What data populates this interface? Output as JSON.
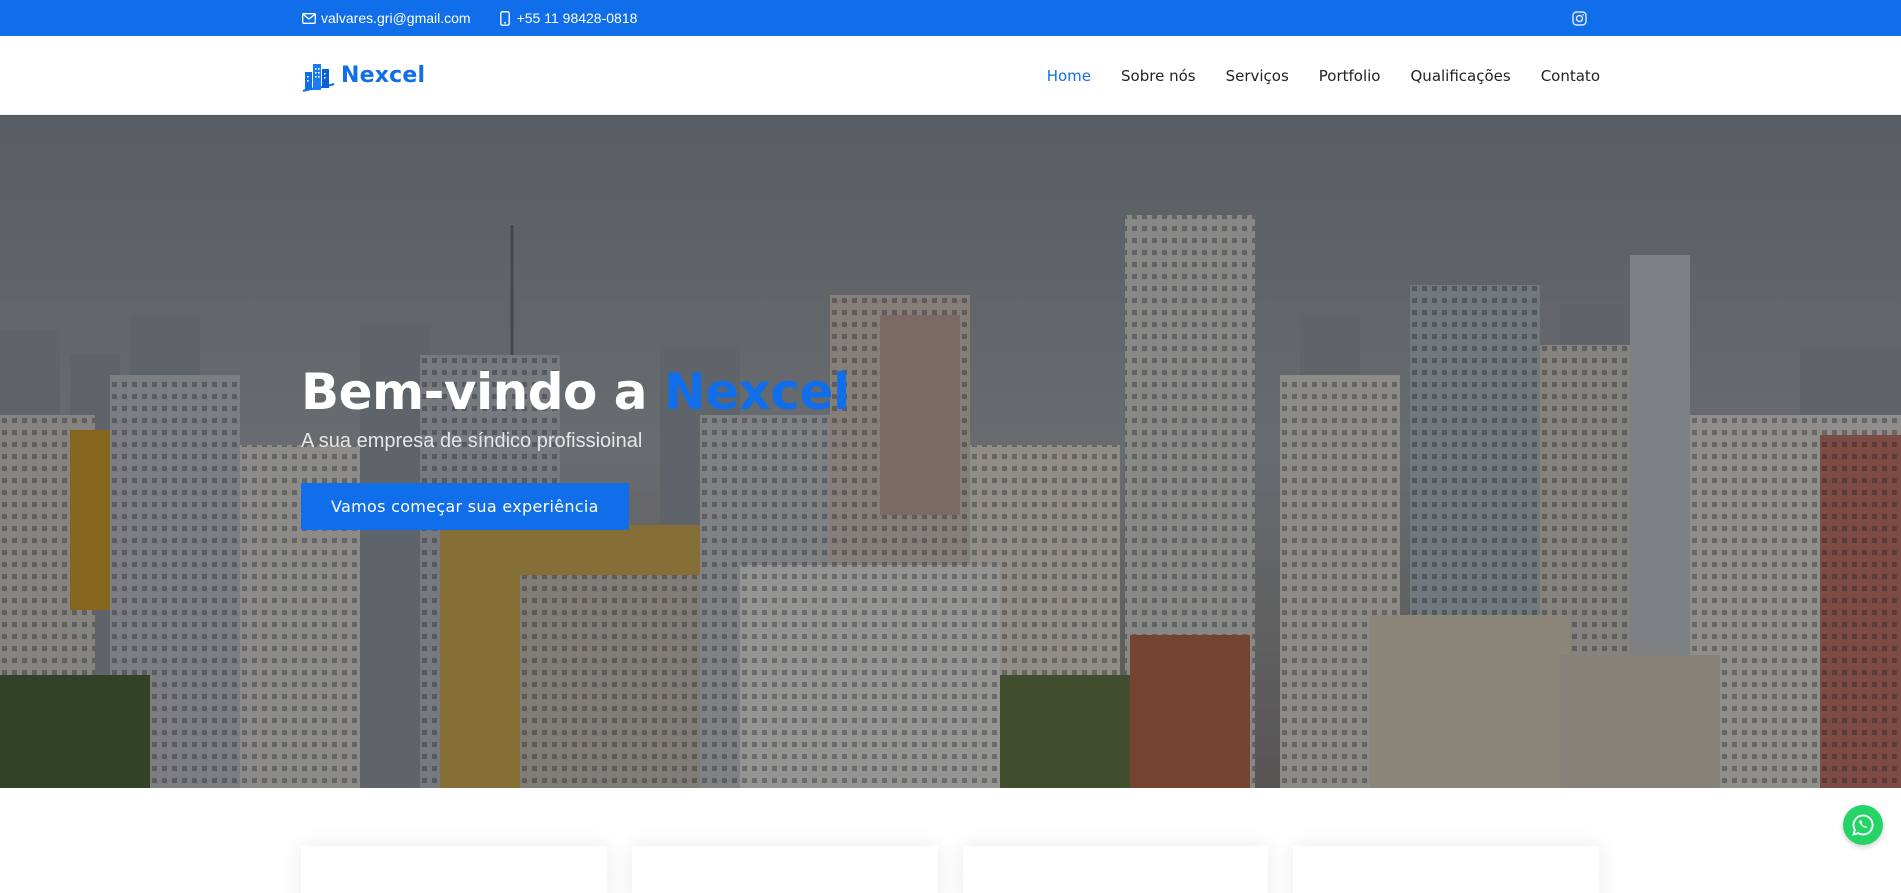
{
  "topbar": {
    "email": "valvares.gri@gmail.com",
    "phone": "+55 11 98428-0818",
    "email_icon": "envelope-icon",
    "phone_icon": "phone-icon",
    "social_icon": "instagram-icon"
  },
  "header": {
    "logo_text": "Nexcel",
    "logo_icon": "buildings-icon",
    "nav": [
      {
        "label": "Home",
        "active": true
      },
      {
        "label": "Sobre nós"
      },
      {
        "label": "Serviços"
      },
      {
        "label": "Portfolio"
      },
      {
        "label": "Qualificações"
      },
      {
        "label": "Contato"
      }
    ]
  },
  "hero": {
    "title_prefix": "Bem-vindo a ",
    "title_brand": "Nexcel",
    "subtitle": "A sua empresa de síndico profissioinal",
    "cta_label": "Vamos começar sua experiência"
  },
  "whatsapp": {
    "icon": "whatsapp-icon"
  },
  "colors": {
    "accent": "#106eea",
    "topbar_bg": "#106eea",
    "whatsapp": "#25d366"
  }
}
